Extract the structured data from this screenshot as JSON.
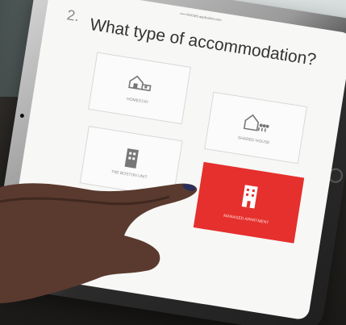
{
  "screen": {
    "status_text": "••••• ROOMS\napplication.com",
    "question_number": "2.",
    "question_title": "What type of accommodation?"
  },
  "options": [
    {
      "label": "HOMESTAY",
      "icon": "houses-icon",
      "selected": false
    },
    {
      "label": "SHARED HOUSE",
      "icon": "shared-house-icon",
      "selected": false
    },
    {
      "label": "THE BOSTON UNIT",
      "icon": "building-icon",
      "selected": false
    },
    {
      "label": "MANAGED APARTMENT",
      "icon": "apartment-building-icon",
      "selected": true
    }
  ],
  "colors": {
    "accent": "#e5302d",
    "screen_bg": "#f7f7f6",
    "card_bg": "#fbfbfb"
  }
}
